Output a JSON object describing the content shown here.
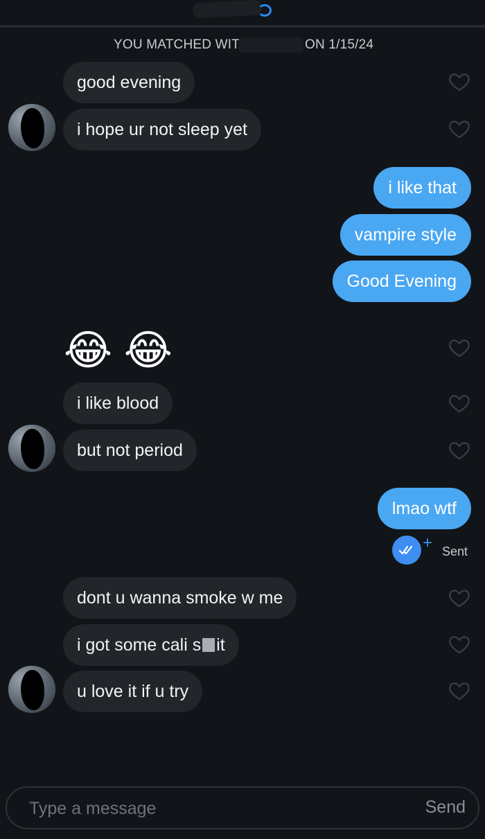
{
  "match_banner": {
    "prefix": "YOU MATCHED WITH",
    "suffix": "ON 1/15/24"
  },
  "messages": [
    {
      "from": "them",
      "text": "good evening"
    },
    {
      "from": "them",
      "text": "i hope ur not sleep yet"
    },
    {
      "from": "me",
      "text": "i like that"
    },
    {
      "from": "me",
      "text": "vampire style"
    },
    {
      "from": "me",
      "text": "Good Evening"
    },
    {
      "from": "them",
      "text": "😂 😂"
    },
    {
      "from": "them",
      "text": "i like blood"
    },
    {
      "from": "them",
      "text": "but not period"
    },
    {
      "from": "me",
      "text": "lmao wtf"
    },
    {
      "from": "them",
      "text": "dont u wanna smoke w me"
    },
    {
      "from": "them",
      "text_before": "i got some cali s",
      "text_after": "it"
    },
    {
      "from": "them",
      "text": "u love it if u try"
    }
  ],
  "status": {
    "sent_label": "Sent"
  },
  "composer": {
    "placeholder": "Type a message",
    "send_label": "Send"
  },
  "colors": {
    "background": "#111418",
    "incoming_bubble": "#22262b",
    "outgoing_bubble": "#4aa7f2",
    "read_receipt": "#3d8ef0"
  },
  "icons": {
    "like": "heart-outline-icon",
    "read": "double-check-icon",
    "add": "plus-icon"
  }
}
